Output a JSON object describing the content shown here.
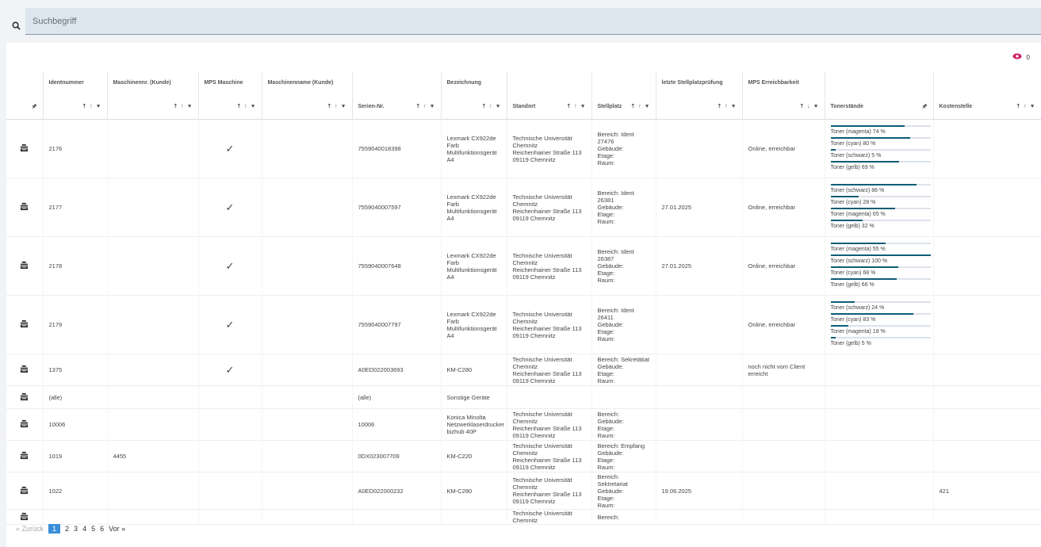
{
  "search": {
    "placeholder": "Suchbegriff"
  },
  "toolbar": {
    "visible_count": "0"
  },
  "columns": {
    "ident": "Identnummer",
    "mnr": "Maschinennr. (Kunde)",
    "mps": "MPS Maschine",
    "mname": "Maschinenname (Kunde)",
    "serial": "Serien-Nr.",
    "bez": "Bezeichnung",
    "standort": "Standort",
    "stell": "Stellplatz",
    "lastcheck": "letzte Stellplatzprüfung",
    "reach": "MPS Erreichbarkeit",
    "toner": "Tonerstände",
    "kst": "Kostenstelle"
  },
  "rows": [
    {
      "ident": "2176",
      "mnr": "",
      "mps": "✓",
      "mname": "",
      "serial": "7559040018398",
      "bez": "Lexmark CX922de Farb Multifunktionsgerät A4",
      "standort": "Technische Universität Chemnitz\nReichenhainer Straße 113\n09119 Chemnitz",
      "stell": "Bereich: Ident 27476\nGebäude:\nEtage:\nRaum:",
      "lastcheck": "",
      "reach": "Online, erreichbar",
      "kst": "",
      "toner": [
        {
          "label": "Toner (magenta) 74 %",
          "v": 74
        },
        {
          "label": "Toner (cyan) 80 %",
          "v": 80
        },
        {
          "label": "Toner (schwarz) 5 %",
          "v": 5
        },
        {
          "label": "Toner (gelb) 69 %",
          "v": 69
        }
      ]
    },
    {
      "ident": "2177",
      "mnr": "",
      "mps": "✓",
      "mname": "",
      "serial": "7559040007597",
      "bez": "Lexmark CX922de Farb Multifunktionsgerät A4",
      "standort": "Technische Universität Chemnitz\nReichenhainer Straße 113\n09119 Chemnitz",
      "stell": "Bereich: Ident 26381\nGebäude:\nEtage:\nRaum:",
      "lastcheck": "27.01.2025",
      "reach": "Online, erreichbar",
      "kst": "",
      "toner": [
        {
          "label": "Toner (schwarz) 86 %",
          "v": 86
        },
        {
          "label": "Toner (cyan) 28 %",
          "v": 28
        },
        {
          "label": "Toner (magenta) 65 %",
          "v": 65
        },
        {
          "label": "Toner (gelb) 32 %",
          "v": 32
        }
      ]
    },
    {
      "ident": "2178",
      "mnr": "",
      "mps": "✓",
      "mname": "",
      "serial": "7559040007648",
      "bez": "Lexmark CX922de Farb Multifunktionsgerät A4",
      "standort": "Technische Universität Chemnitz\nReichenhainer Straße 113\n09119 Chemnitz",
      "stell": "Bereich: Ident 26387\nGebäude:\nEtage:\nRaum:",
      "lastcheck": "27.01.2025",
      "reach": "Online, erreichbar",
      "kst": "",
      "toner": [
        {
          "label": "Toner (magenta) 55 %",
          "v": 55
        },
        {
          "label": "Toner (schwarz) 100 %",
          "v": 100
        },
        {
          "label": "Toner (cyan) 68 %",
          "v": 68
        },
        {
          "label": "Toner (gelb) 66 %",
          "v": 66
        }
      ]
    },
    {
      "ident": "2179",
      "mnr": "",
      "mps": "✓",
      "mname": "",
      "serial": "7559040007797",
      "bez": "Lexmark CX922de Farb Multifunktionsgerät A4",
      "standort": "Technische Universität Chemnitz\nReichenhainer Straße 113\n09119 Chemnitz",
      "stell": "Bereich: Ident 26411\nGebäude:\nEtage:\nRaum:",
      "lastcheck": "",
      "reach": "Online, erreichbar",
      "kst": "",
      "toner": [
        {
          "label": "Toner (schwarz) 24 %",
          "v": 24
        },
        {
          "label": "Toner (cyan) 83 %",
          "v": 83
        },
        {
          "label": "Toner (magenta) 18 %",
          "v": 18
        },
        {
          "label": "Toner (gelb) 5 %",
          "v": 5
        }
      ]
    },
    {
      "ident": "1375",
      "mnr": "",
      "mps": "✓",
      "mname": "",
      "serial": "A0ED022003693",
      "bez": "KM-C280",
      "standort": "Technische Universität Chemnitz\nReichenhainer Straße 113\n09119 Chemnitz",
      "stell": "Bereich: Sekretätiat\nGebäude:\nEtage:\nRaum:",
      "lastcheck": "",
      "reach": "noch nicht vom Client erreicht",
      "kst": "",
      "toner": []
    },
    {
      "ident": "(alle)",
      "mnr": "",
      "mps": "",
      "mname": "",
      "serial": "(alle)",
      "bez": "Sonstige Geräte",
      "standort": "",
      "stell": "",
      "lastcheck": "",
      "reach": "",
      "kst": "",
      "toner": []
    },
    {
      "ident": "10006",
      "mnr": "",
      "mps": "",
      "mname": "",
      "serial": "10006",
      "bez": "Konica Minolta Netzwerklaserdrucker bizhub 40P",
      "standort": "Technische Universität Chemnitz\nReichenhainer Straße 113\n09119 Chemnitz",
      "stell": "Bereich:\nGebäude:\nEtage:\nRaum:",
      "lastcheck": "",
      "reach": "",
      "kst": "",
      "toner": []
    },
    {
      "ident": "1019",
      "mnr": "4455",
      "mps": "",
      "mname": "",
      "serial": "0DX023007709",
      "bez": "KM-C220",
      "standort": "Technische Universität Chemnitz\nReichenhainer Straße 113\n09119 Chemnitz",
      "stell": "Bereich: Empfang\nGebäude:\nEtage:\nRaum:",
      "lastcheck": "",
      "reach": "",
      "kst": "",
      "toner": []
    },
    {
      "ident": "1022",
      "mnr": "",
      "mps": "",
      "mname": "",
      "serial": "A0ED022000232",
      "bez": "KM-C280",
      "standort": "Technische Universität Chemnitz\nReichenhainer Straße 113\n09119 Chemnitz",
      "stell": "Bereich: Sektretariat\nGebäude:\nEtage:\nRaum:",
      "lastcheck": "19.06.2025",
      "reach": "",
      "kst": "421",
      "toner": []
    },
    {
      "ident": "",
      "mnr": "",
      "mps": "",
      "mname": "",
      "serial": "",
      "bez": "",
      "standort": "Technische Universität Chemnitz",
      "stell": "Bereich:",
      "lastcheck": "",
      "reach": "",
      "kst": "",
      "toner": []
    }
  ],
  "pager": {
    "prev": "« Zurück",
    "pages": [
      "1",
      "2",
      "3",
      "4",
      "5",
      "6"
    ],
    "next": "Vor »"
  }
}
